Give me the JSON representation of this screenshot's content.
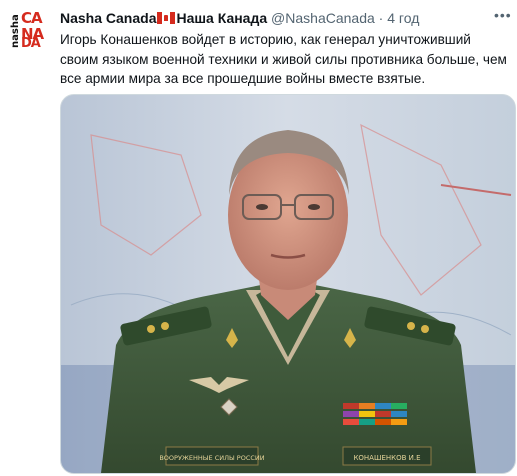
{
  "tweet": {
    "author_name": "Nasha Canada",
    "author_name_ru": "Наша Канада",
    "handle": "@NashaCanada",
    "separator": "·",
    "timestamp": "4 год",
    "more_icon": "more-options-icon",
    "flag_icon": "canada-flag-icon",
    "text": "Игорь Конашенков войдет в историю, как генерал уничтоживший своим языком военной техники и живой силы противника больше, чем все армии мира за все прошедшие войны вместе взятые."
  },
  "avatar": {
    "logo_text_vertical": "nasha",
    "logo_text_ca": "CA",
    "logo_text_na": "NA",
    "logo_text_da": "DA",
    "brand_color": "#d52b1e"
  },
  "media": {
    "patch_text": "ВООРУЖЕННЫЕ СИЛЫ РОССИИ",
    "name_tag": "КОНАШЕНКОВ И.Е",
    "uniform_color": "#3d5a3a",
    "background_color": "#c6d0dd"
  }
}
